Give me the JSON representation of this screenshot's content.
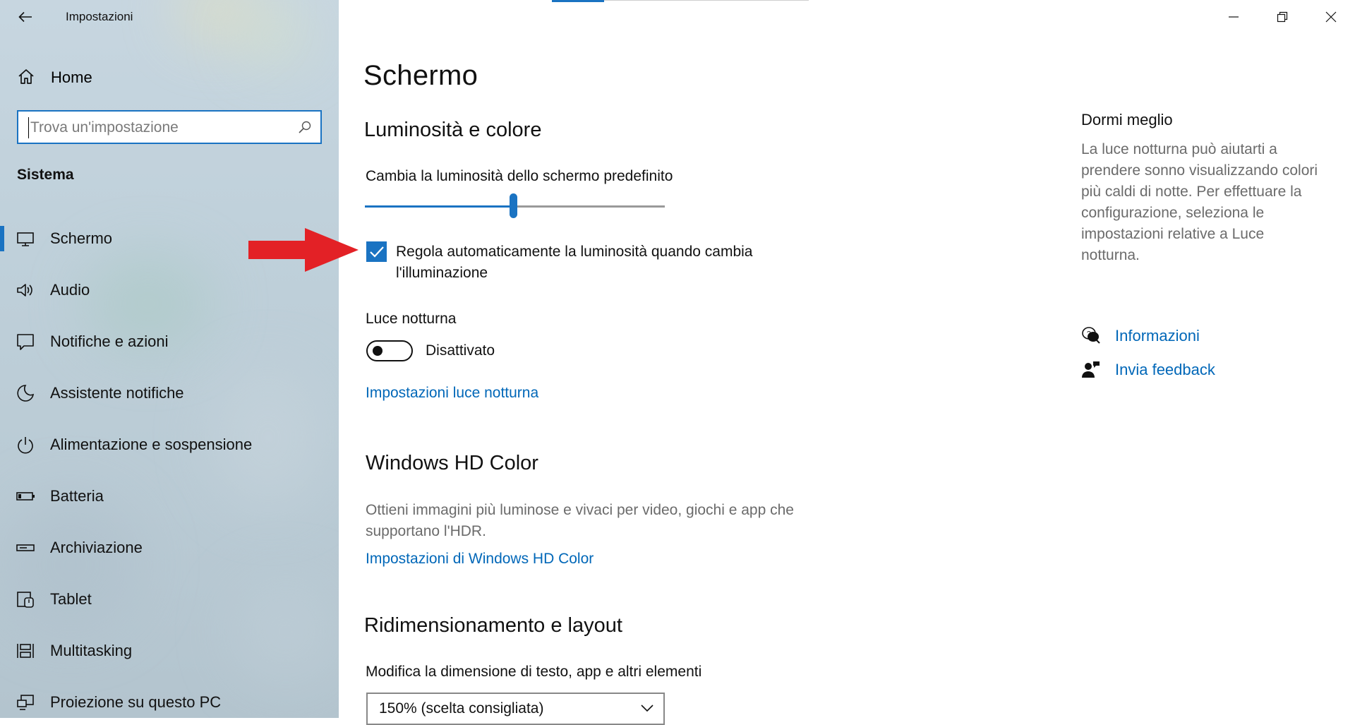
{
  "window": {
    "title": "Impostazioni",
    "controls": [
      "minimize",
      "restore",
      "close"
    ]
  },
  "sidebar": {
    "home_label": "Home",
    "search_placeholder": "Trova un'impostazione",
    "section": "Sistema",
    "items": [
      {
        "label": "Schermo",
        "icon": "monitor-icon",
        "selected": true
      },
      {
        "label": "Audio",
        "icon": "speaker-icon",
        "selected": false
      },
      {
        "label": "Notifiche e azioni",
        "icon": "notification-icon",
        "selected": false
      },
      {
        "label": "Assistente notifiche",
        "icon": "moon-icon",
        "selected": false
      },
      {
        "label": "Alimentazione e sospensione",
        "icon": "power-icon",
        "selected": false
      },
      {
        "label": "Batteria",
        "icon": "battery-icon",
        "selected": false
      },
      {
        "label": "Archiviazione",
        "icon": "storage-icon",
        "selected": false
      },
      {
        "label": "Tablet",
        "icon": "tablet-icon",
        "selected": false
      },
      {
        "label": "Multitasking",
        "icon": "multitasking-icon",
        "selected": false
      },
      {
        "label": "Proiezione su questo PC",
        "icon": "projection-icon",
        "selected": false
      }
    ]
  },
  "main": {
    "title": "Schermo",
    "brightness": {
      "heading": "Luminosità e colore",
      "slider_label": "Cambia la luminosità dello schermo predefinito",
      "slider_value": 0.5,
      "auto_checkbox_checked": true,
      "auto_checkbox_line1": "Regola automaticamente la luminosità quando cambia",
      "auto_checkbox_line2": "l'illuminazione"
    },
    "night_light": {
      "label": "Luce notturna",
      "toggle_on": false,
      "toggle_state": "Disattivato",
      "settings_link": "Impostazioni luce notturna"
    },
    "hd_color": {
      "heading": "Windows HD Color",
      "desc_line1": "Ottieni immagini più luminose e vivaci per video, giochi e app che",
      "desc_line2": "supportano l'HDR.",
      "link": "Impostazioni di Windows HD Color"
    },
    "scaling": {
      "heading": "Ridimensionamento e layout",
      "label": "Modifica la dimensione di testo, app e altri elementi",
      "selected": "150% (scelta consigliata)"
    }
  },
  "aside": {
    "title": "Dormi meglio",
    "lines": [
      "La luce notturna può aiutarti a",
      "prendere sonno visualizzando colori",
      "più caldi di notte. Per effettuare la",
      "configurazione, seleziona le",
      "impostazioni relative a Luce",
      "notturna."
    ],
    "links": [
      {
        "label": "Informazioni",
        "icon": "help-chat-icon"
      },
      {
        "label": "Invia feedback",
        "icon": "feedback-icon"
      }
    ]
  },
  "colors": {
    "accent": "#1a73c2",
    "link": "#0067b8",
    "annotation_arrow": "#e32126"
  }
}
